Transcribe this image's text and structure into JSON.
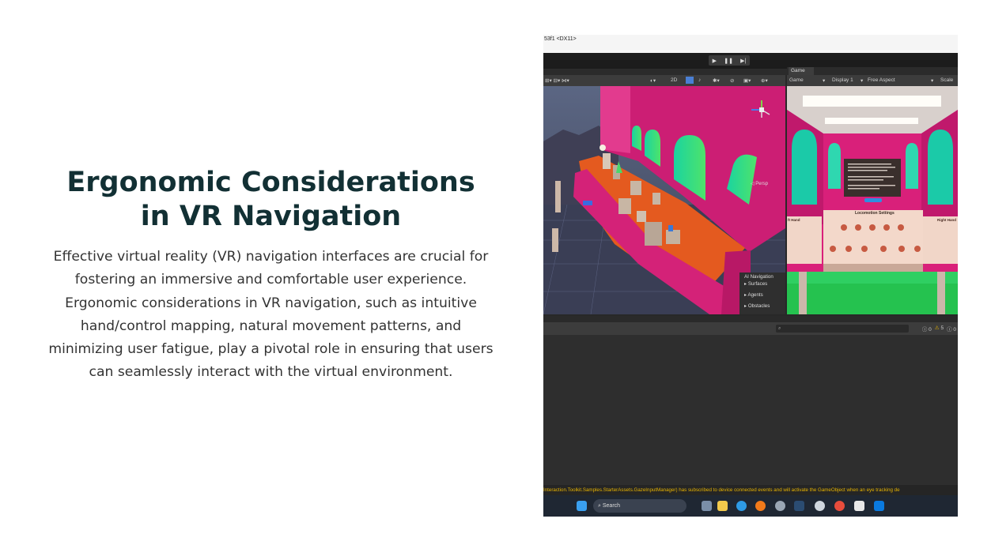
{
  "slide": {
    "title_lines": [
      "Ergonomic Considerations",
      "in VR Navigation"
    ],
    "body_lines": [
      "Effective virtual reality (VR) navigation interfaces are crucial for",
      "fostering an immersive and comfortable user experience.",
      "Ergonomic considerations in VR navigation, such as intuitive",
      "hand/control mapping, natural movement patterns, and",
      "minimizing user fatigue, play a pivotal role in ensuring that users",
      "can seamlessly interact with the virtual environment."
    ]
  },
  "editor": {
    "window_title": "53f1 <DX11>",
    "play_controls": {
      "play": "▶",
      "pause": "❚❚",
      "step": "▶|"
    },
    "scene": {
      "toolbar_2d": "2D",
      "persp_label": "◁ Persp",
      "ai_navigation": {
        "title": "AI Navigation",
        "items": [
          "Surfaces",
          "Agents",
          "Obstacles"
        ]
      }
    },
    "game": {
      "tab_label": "Game",
      "mode": "Game",
      "display": "Display 1",
      "aspect": "Free Aspect",
      "scale": "Scale",
      "left_hand": "ft Hand",
      "right_hand": "Right Hand",
      "locomotion_title": "Locomotion Settings"
    },
    "console": {
      "search_placeholder": "",
      "counts": {
        "logs": "0",
        "warnings": "5",
        "errors": "0"
      },
      "status_message": "Interaction.Toolkit.Samples.StarterAssets.GazeInputManager) has subscribed to device connected events and will activate the GameObject when an eye tracking de"
    },
    "taskbar": {
      "search_label": "Search"
    },
    "colors": {
      "accent_pink": "#d9207a",
      "warning": "#e7b400",
      "editor_bg": "#282828"
    }
  }
}
